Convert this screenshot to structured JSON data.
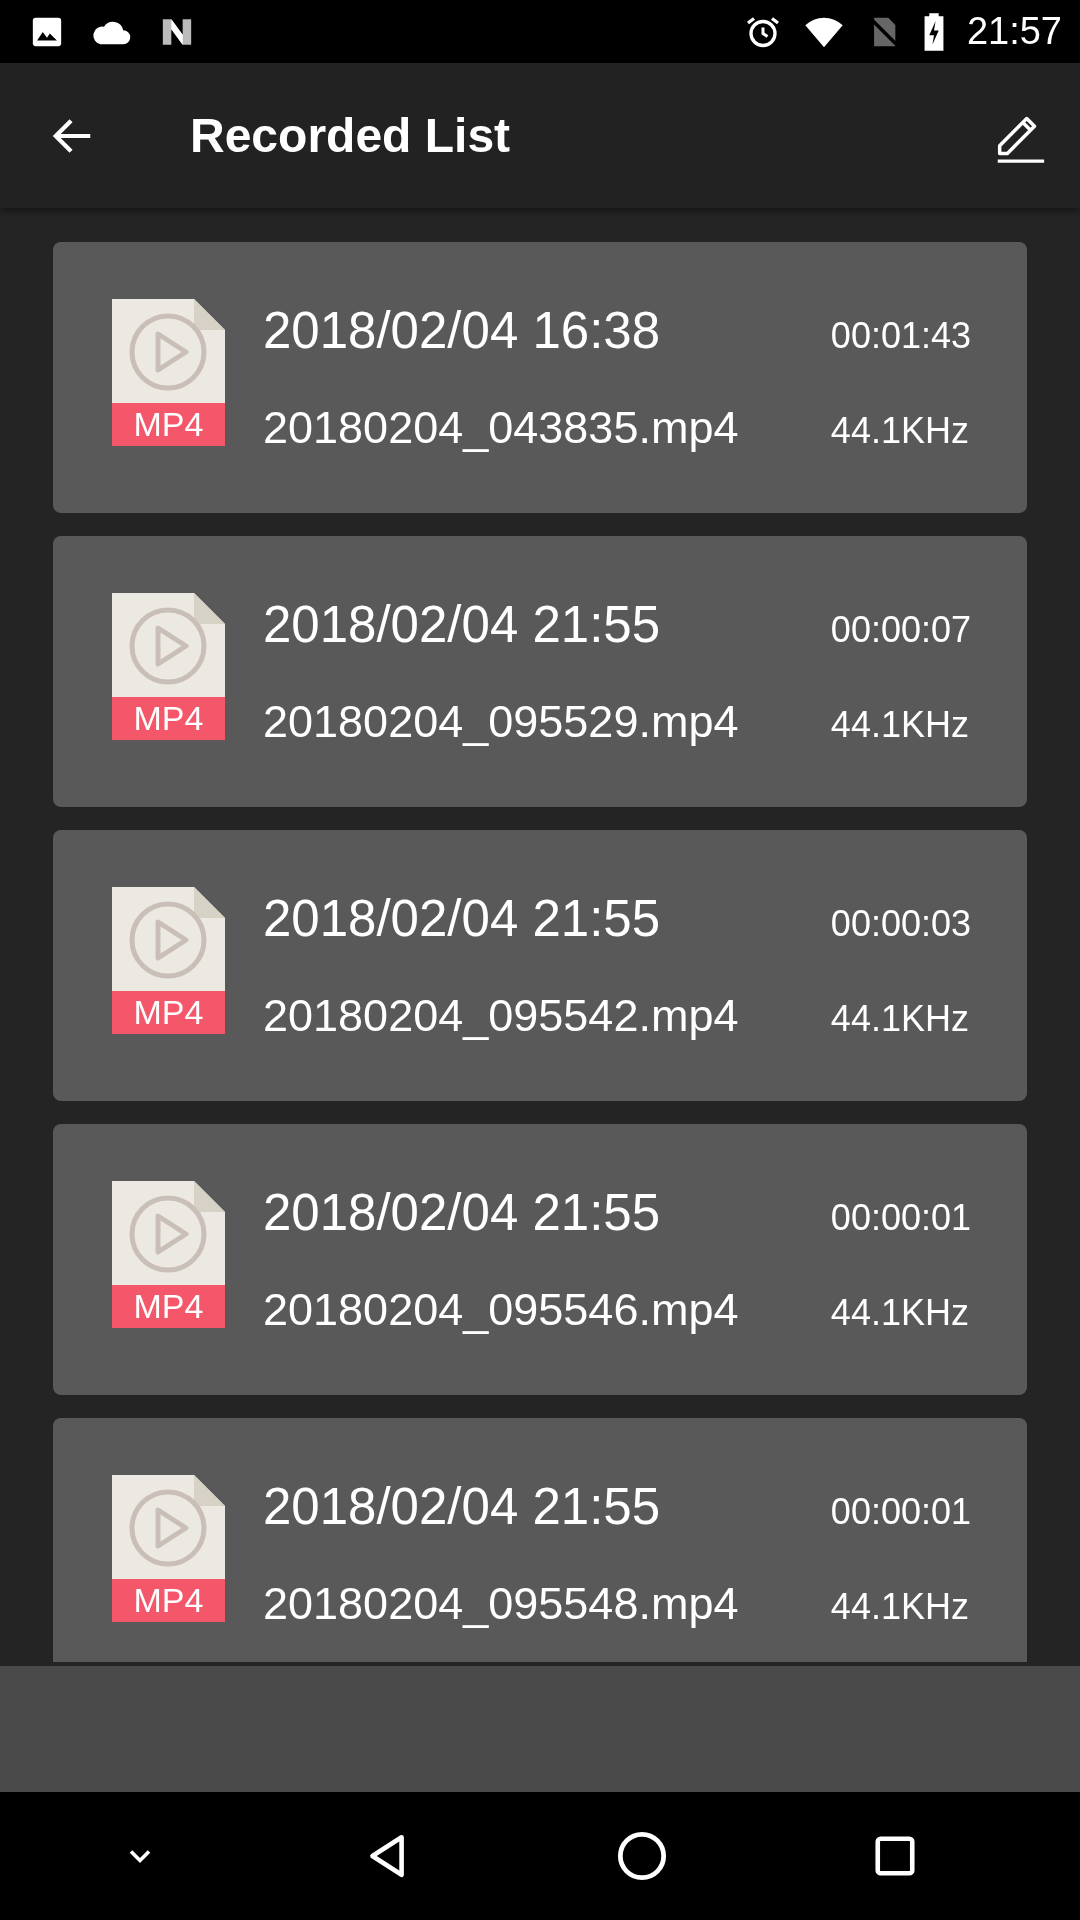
{
  "status_bar": {
    "time": "21:57"
  },
  "app_bar": {
    "title": "Recorded List"
  },
  "recordings": [
    {
      "badge": "MP4",
      "date": "2018/02/04 16:38",
      "duration": "00:01:43",
      "filename": "20180204_043835.mp4",
      "sample_rate": "44.1KHz"
    },
    {
      "badge": "MP4",
      "date": "2018/02/04 21:55",
      "duration": "00:00:07",
      "filename": "20180204_095529.mp4",
      "sample_rate": "44.1KHz"
    },
    {
      "badge": "MP4",
      "date": "2018/02/04 21:55",
      "duration": "00:00:03",
      "filename": "20180204_095542.mp4",
      "sample_rate": "44.1KHz"
    },
    {
      "badge": "MP4",
      "date": "2018/02/04 21:55",
      "duration": "00:00:01",
      "filename": "20180204_095546.mp4",
      "sample_rate": "44.1KHz"
    },
    {
      "badge": "MP4",
      "date": "2018/02/04 21:55",
      "duration": "00:00:01",
      "filename": "20180204_095548.mp4",
      "sample_rate": "44.1KHz"
    }
  ]
}
